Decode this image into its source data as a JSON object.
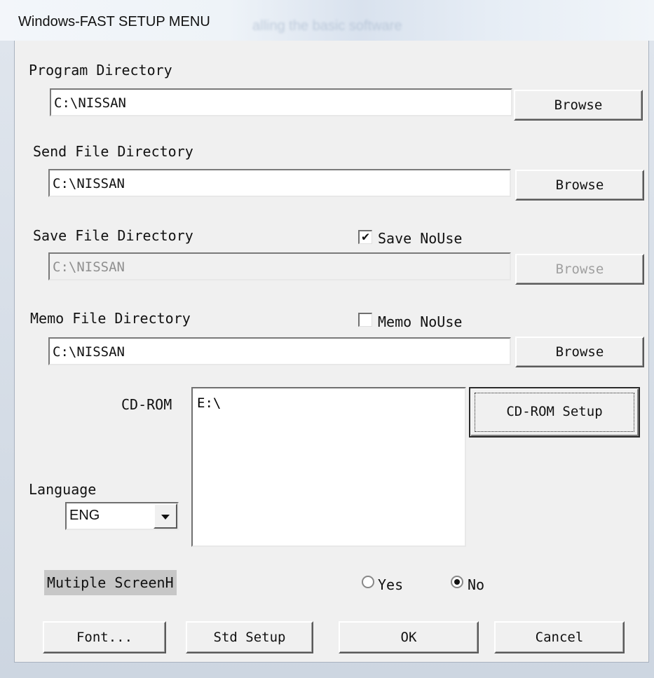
{
  "window": {
    "title": "Windows-FAST SETUP MENU",
    "background_caption": "alling the basic software"
  },
  "program_dir": {
    "label": "Program Directory",
    "value": "C:\\NISSAN",
    "browse": "Browse"
  },
  "send_dir": {
    "label": "Send File Directory",
    "value": "C:\\NISSAN",
    "browse": "Browse"
  },
  "save_dir": {
    "label": "Save File Directory",
    "value": "C:\\NISSAN",
    "browse": "Browse",
    "nouse_label": "Save NoUse",
    "nouse_checked": true
  },
  "memo_dir": {
    "label": "Memo File Directory",
    "value": "C:\\NISSAN",
    "browse": "Browse",
    "nouse_label": "Memo NoUse",
    "nouse_checked": false
  },
  "cdrom": {
    "label": "CD-ROM",
    "drives": [
      "E:\\"
    ],
    "setup_button": "CD-ROM Setup"
  },
  "language": {
    "label": "Language",
    "selected": "ENG"
  },
  "multiple_screen": {
    "label": "Mutiple ScreenH",
    "options": [
      "Yes",
      "No"
    ],
    "selected": "No"
  },
  "buttons": {
    "font": "Font...",
    "std_setup": "Std Setup",
    "ok": "OK",
    "cancel": "Cancel"
  },
  "checkmark_glyph": "✔"
}
